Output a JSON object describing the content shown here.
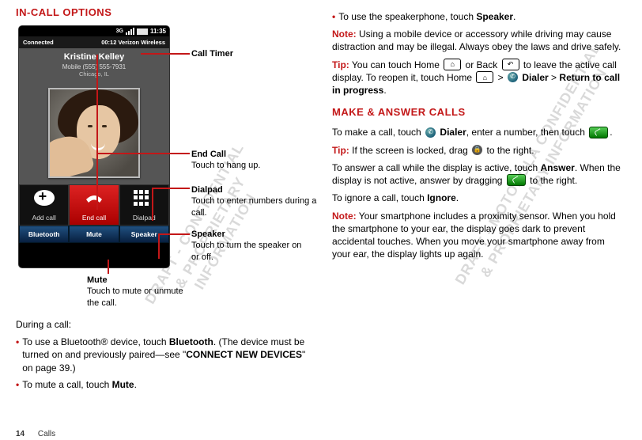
{
  "left": {
    "title": "IN-CALL OPTIONS",
    "phone": {
      "time": "11:35",
      "connected": "Connected",
      "duration": "00:12 Verizon Wireless",
      "caller_name": "Kristine Kelley",
      "caller_phone": "Mobile (555) 555-7931",
      "caller_loc": "Chicago, IL",
      "add": "Add call",
      "end": "End call",
      "dialpad": "Dialpad",
      "bluetooth": "Bluetooth",
      "mute": "Mute",
      "speaker": "Speaker"
    },
    "callouts": {
      "timer": "Call Timer",
      "endcall_t": "End Call",
      "endcall_d": "Touch to hang up.",
      "dialpad_t": "Dialpad",
      "dialpad_d": "Touch to enter numbers during a call.",
      "speaker_t": "Speaker",
      "speaker_d": "Touch to turn the speaker on or off.",
      "mute_t": "Mute",
      "mute_d": "Touch to mute or unmute the call."
    },
    "during": "During a call:",
    "b1a": "To use a Bluetooth® device, touch ",
    "b1b": "Bluetooth",
    "b1c": ". (The device must be turned on and previously paired—see \"",
    "b1d": "CONNECT NEW DEVICES",
    "b1e": "\" on page 39.)",
    "b2a": "To mute a call, touch ",
    "b2b": "Mute",
    "b2c": "."
  },
  "right": {
    "sp_a": "To use the speakerphone, touch ",
    "sp_b": "Speaker",
    "sp_c": ".",
    "note_t": "Note:",
    "note_d": " Using a mobile device or accessory while driving may cause distraction and may be illegal. Always obey the laws and drive safely.",
    "tip1_t": "Tip:",
    "tip1_a": " You can touch Home ",
    "tip1_b": " or Back ",
    "tip1_c": " to leave the active call display. To reopen it, touch Home ",
    "tip1_d": " > ",
    "tip1_dialer": "Dialer",
    "tip1_e": " > ",
    "tip1_return": "Return to call in progress",
    "tip1_f": ".",
    "title2": "MAKE & ANSWER CALLS",
    "make_a": "To make a call, touch ",
    "make_dialer": "Dialer",
    "make_b": ", enter a number, then touch ",
    "make_c": ".",
    "tip2_t": "Tip:",
    "tip2_a": " If the screen is locked, drag ",
    "tip2_b": " to the right.",
    "ans_a": "To answer a call while the display is active, touch ",
    "ans_b": "Answer",
    "ans_c": ". When the display is not active, answer by dragging ",
    "ans_d": " to the right.",
    "ign_a": "To ignore a call, touch ",
    "ign_b": "Ignore",
    "ign_c": ".",
    "note2_t": "Note:",
    "note2_d": " Your smartphone includes a proximity sensor. When you hold the smartphone to your ear, the display goes dark to prevent accidental touches. When you move your smartphone away from your ear, the display lights up again."
  },
  "wm1": "DRAFT - CONFIDENTIAL\n& PROPRIETARY\nINFORMATION",
  "wm2": "DRAFT - MOTOROLA CONFIDENTIAL\n& PROPRIETARY INFORMATION",
  "footer_page": "14",
  "footer_section": "Calls"
}
